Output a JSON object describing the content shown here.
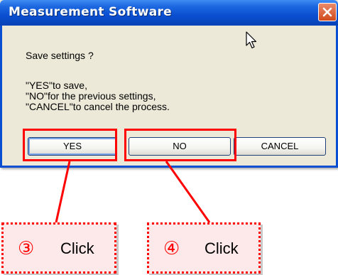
{
  "dialog": {
    "title": "Measurement Software",
    "question": "Save settings ?",
    "lines": [
      "\"YES\"to save,",
      "\"NO\"for the previous settings,",
      "\"CANCEL\"to cancel the process."
    ],
    "buttons": {
      "yes": "YES",
      "no": "NO",
      "cancel": "CANCEL"
    }
  },
  "annotations": {
    "step3": {
      "number": "③",
      "label": "Click"
    },
    "step4": {
      "number": "④",
      "label": "Click"
    }
  },
  "colors": {
    "titlebar": "#0a4fd1",
    "dialog_bg": "#ece9d8",
    "highlight": "#ff0000",
    "callout_bg": "#fde9e9"
  }
}
